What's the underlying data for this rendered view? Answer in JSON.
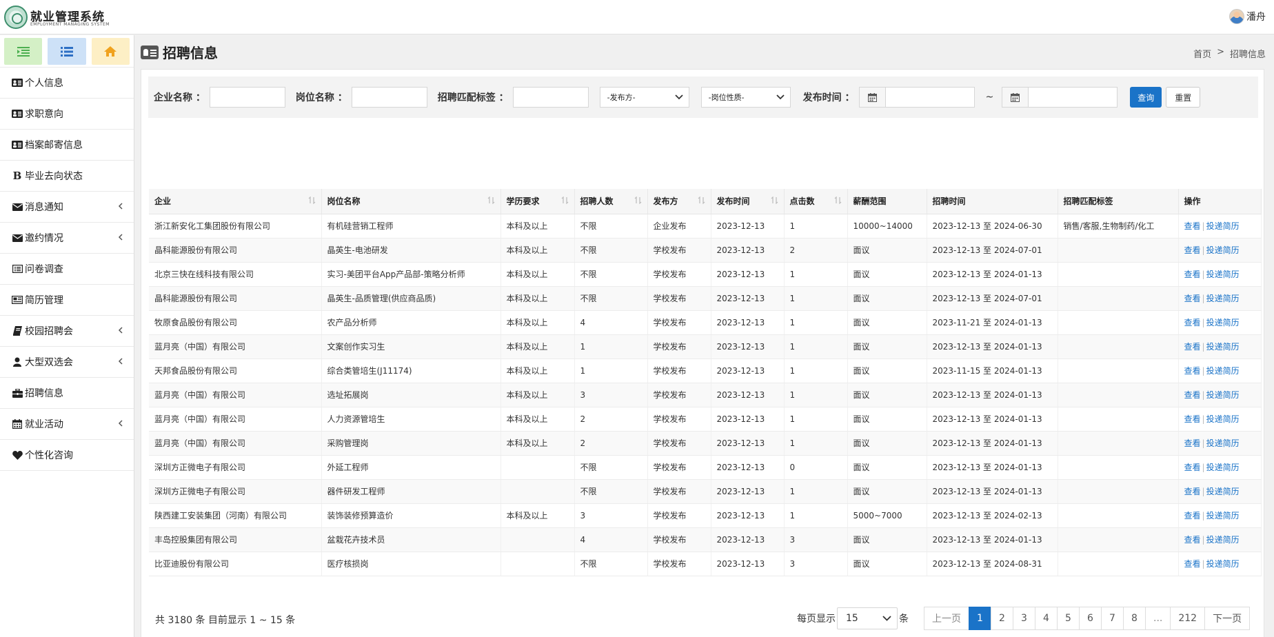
{
  "header": {
    "app_title": "就业管理系统",
    "app_subtitle": "EMPLOYMENT MANAGING SYSTEM",
    "user_name": "潘舟"
  },
  "sidebar": {
    "items": [
      {
        "label": "个人信息",
        "icon": "id-card-icon",
        "has_children": false
      },
      {
        "label": "求职意向",
        "icon": "id-card-icon",
        "has_children": false
      },
      {
        "label": "档案邮寄信息",
        "icon": "id-card-icon",
        "has_children": false
      },
      {
        "label": "毕业去向状态",
        "icon": "bold-b-icon",
        "has_children": false
      },
      {
        "label": "消息通知",
        "icon": "envelope-icon",
        "has_children": true
      },
      {
        "label": "邀约情况",
        "icon": "envelope-icon",
        "has_children": true
      },
      {
        "label": "问卷调查",
        "icon": "list-alt-icon",
        "has_children": false
      },
      {
        "label": "简历管理",
        "icon": "newspaper-icon",
        "has_children": false
      },
      {
        "label": "校园招聘会",
        "icon": "book-icon",
        "has_children": true
      },
      {
        "label": "大型双选会",
        "icon": "user-icon",
        "has_children": true
      },
      {
        "label": "招聘信息",
        "icon": "briefcase-icon",
        "has_children": false
      },
      {
        "label": "就业活动",
        "icon": "calendar-icon",
        "has_children": true
      },
      {
        "label": "个性化咨询",
        "icon": "heart-icon",
        "has_children": false
      }
    ]
  },
  "page": {
    "title": "招聘信息",
    "breadcrumb": {
      "home": "首页",
      "separator": ">",
      "current": "招聘信息"
    }
  },
  "filters": {
    "company_label": "企业名称 ：",
    "position_label": "岗位名称 ：",
    "tag_label": "招聘匹配标签 ：",
    "publisher_select": "-发布方-",
    "nature_select": "-岗位性质-",
    "date_label": "发布时间 ：",
    "date_sep": "~",
    "query_button": "查询",
    "reset_button": "重置"
  },
  "table": {
    "columns": [
      "企业",
      "岗位名称",
      "学历要求",
      "招聘人数",
      "发布方",
      "发布时间",
      "点击数",
      "薪酬范围",
      "招聘时间",
      "招聘匹配标签",
      "操作"
    ],
    "view_label": "查看",
    "apply_label": "投递简历",
    "rows": [
      [
        "浙江新安化工集团股份有限公司",
        "有机硅营销工程师",
        "本科及以上",
        "不限",
        "企业发布",
        "2023-12-13",
        "1",
        "10000~14000",
        "2023-12-13 至 2024-06-30",
        "销售/客服,生物制药/化工"
      ],
      [
        "晶科能源股份有限公司",
        "晶英生-电池研发",
        "本科及以上",
        "不限",
        "学校发布",
        "2023-12-13",
        "2",
        "面议",
        "2023-12-13 至 2024-07-01",
        ""
      ],
      [
        "北京三快在线科技有限公司",
        "实习-美团平台App产品部-策略分析师",
        "本科及以上",
        "不限",
        "学校发布",
        "2023-12-13",
        "1",
        "面议",
        "2023-12-13 至 2024-01-13",
        ""
      ],
      [
        "晶科能源股份有限公司",
        "晶英生-品质管理(供应商品质)",
        "本科及以上",
        "不限",
        "学校发布",
        "2023-12-13",
        "1",
        "面议",
        "2023-12-13 至 2024-07-01",
        ""
      ],
      [
        "牧原食品股份有限公司",
        "农产品分析师",
        "本科及以上",
        "4",
        "学校发布",
        "2023-12-13",
        "1",
        "面议",
        "2023-11-21 至 2024-01-13",
        ""
      ],
      [
        "蓝月亮（中国）有限公司",
        "文案创作实习生",
        "本科及以上",
        "1",
        "学校发布",
        "2023-12-13",
        "1",
        "面议",
        "2023-12-13 至 2024-01-13",
        ""
      ],
      [
        "天邦食品股份有限公司",
        "综合类管培生(J11174)",
        "本科及以上",
        "1",
        "学校发布",
        "2023-12-13",
        "1",
        "面议",
        "2023-11-15 至 2024-01-13",
        ""
      ],
      [
        "蓝月亮（中国）有限公司",
        "选址拓展岗",
        "本科及以上",
        "3",
        "学校发布",
        "2023-12-13",
        "1",
        "面议",
        "2023-12-13 至 2024-01-13",
        ""
      ],
      [
        "蓝月亮（中国）有限公司",
        "人力资源管培生",
        "本科及以上",
        "2",
        "学校发布",
        "2023-12-13",
        "1",
        "面议",
        "2023-12-13 至 2024-01-13",
        ""
      ],
      [
        "蓝月亮（中国）有限公司",
        "采购管理岗",
        "本科及以上",
        "2",
        "学校发布",
        "2023-12-13",
        "1",
        "面议",
        "2023-12-13 至 2024-01-13",
        ""
      ],
      [
        "深圳方正微电子有限公司",
        "外延工程师",
        "",
        "不限",
        "学校发布",
        "2023-12-13",
        "0",
        "面议",
        "2023-12-13 至 2024-01-13",
        ""
      ],
      [
        "深圳方正微电子有限公司",
        "器件研发工程师",
        "",
        "不限",
        "学校发布",
        "2023-12-13",
        "1",
        "面议",
        "2023-12-13 至 2024-01-13",
        ""
      ],
      [
        "陕西建工安装集团（河南）有限公司",
        "装饰装修预算造价",
        "本科及以上",
        "3",
        "学校发布",
        "2023-12-13",
        "1",
        "5000~7000",
        "2023-12-13 至 2024-02-13",
        ""
      ],
      [
        "丰岛控股集团有限公司",
        "盆栽花卉技术员",
        "",
        "4",
        "学校发布",
        "2023-12-13",
        "3",
        "面议",
        "2023-12-13 至 2024-01-13",
        ""
      ],
      [
        "比亚迪股份有限公司",
        "医疗核损岗",
        "",
        "不限",
        "学校发布",
        "2023-12-13",
        "3",
        "面议",
        "2023-12-13 至 2024-08-31",
        ""
      ]
    ]
  },
  "footer": {
    "total_text": "共 3180 条 目前显示 1 ~ 15 条",
    "per_page_label": "每页显示",
    "per_page_value": "15",
    "per_page_unit": "条",
    "pagination": {
      "prev": "上一页",
      "pages": [
        "1",
        "2",
        "3",
        "4",
        "5",
        "6",
        "7",
        "8",
        "...",
        "212"
      ],
      "current": "1",
      "next": "下一页"
    }
  },
  "colors": {
    "accent": "#1a73c8",
    "tool_green": "#d4f0c6",
    "tool_blue": "#cde1f7",
    "tool_yellow": "#fdefc5"
  }
}
